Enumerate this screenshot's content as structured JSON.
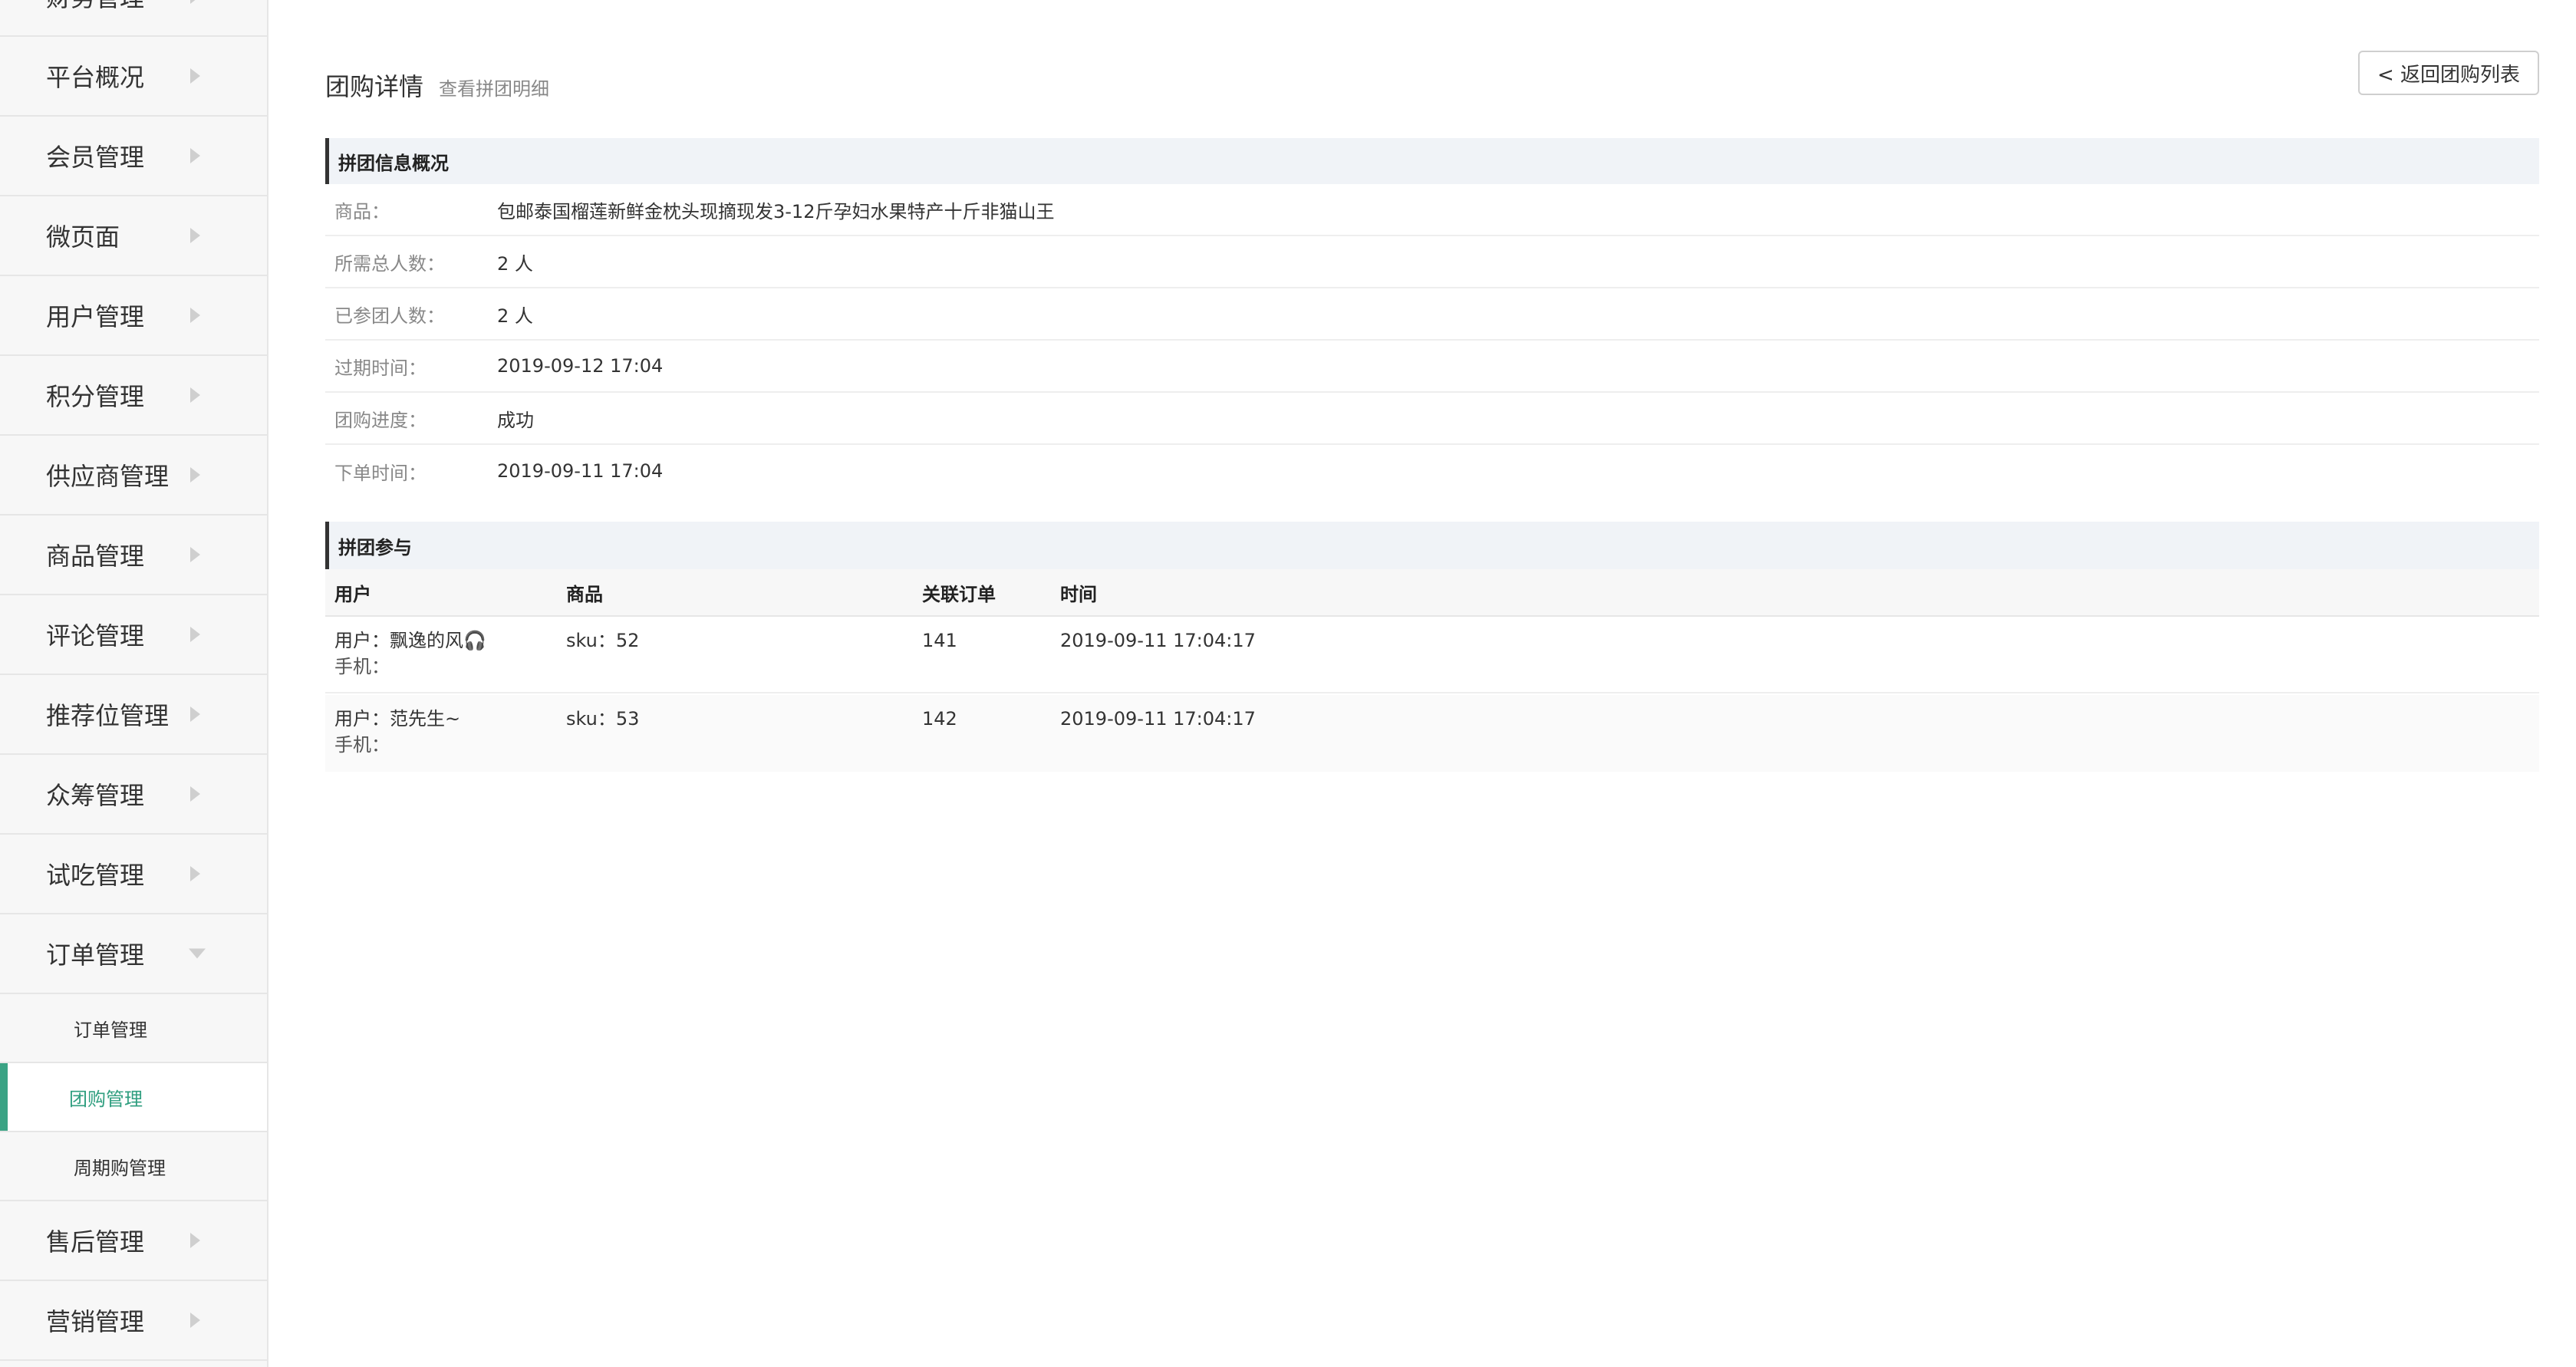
{
  "sidebar": {
    "items": [
      {
        "label": "财务管理"
      },
      {
        "label": "平台概况"
      },
      {
        "label": "会员管理"
      },
      {
        "label": "微页面"
      },
      {
        "label": "用户管理"
      },
      {
        "label": "积分管理"
      },
      {
        "label": "供应商管理"
      },
      {
        "label": "商品管理"
      },
      {
        "label": "评论管理"
      },
      {
        "label": "推荐位管理"
      },
      {
        "label": "众筹管理"
      },
      {
        "label": "试吃管理"
      },
      {
        "label": "订单管理"
      }
    ],
    "sub_items": [
      {
        "label": "订单管理"
      },
      {
        "label": "团购管理"
      },
      {
        "label": "周期购管理"
      }
    ],
    "items_after": [
      {
        "label": "售后管理"
      },
      {
        "label": "营销管理"
      }
    ],
    "accent_color": "#3aa384"
  },
  "header": {
    "title": "团购详情",
    "subtitle": "查看拼团明细",
    "back_button": "< 返回团购列表"
  },
  "overview": {
    "section_title": "拼团信息概况",
    "rows": [
      {
        "label": "商品：",
        "value": "包邮泰国榴莲新鲜金枕头现摘现发3-12斤孕妇水果特产十斤非猫山王"
      },
      {
        "label": "所需总人数：",
        "value": "2 人"
      },
      {
        "label": "已参团人数：",
        "value": "2 人"
      },
      {
        "label": "过期时间：",
        "value": "2019-09-12 17:04"
      },
      {
        "label": "团购进度：",
        "value": "成功"
      },
      {
        "label": "下单时间：",
        "value": "2019-09-11 17:04"
      }
    ]
  },
  "participants": {
    "section_title": "拼团参与",
    "columns": [
      "用户",
      "商品",
      "关联订单",
      "时间"
    ],
    "rows": [
      {
        "user": "用户：飘逸的风🎧",
        "phone": "手机：",
        "goods": "sku：52",
        "order": "141",
        "time": "2019-09-11 17:04:17"
      },
      {
        "user": "用户：范先生~",
        "phone": "手机：",
        "goods": "sku：53",
        "order": "142",
        "time": "2019-09-11 17:04:17"
      }
    ]
  }
}
